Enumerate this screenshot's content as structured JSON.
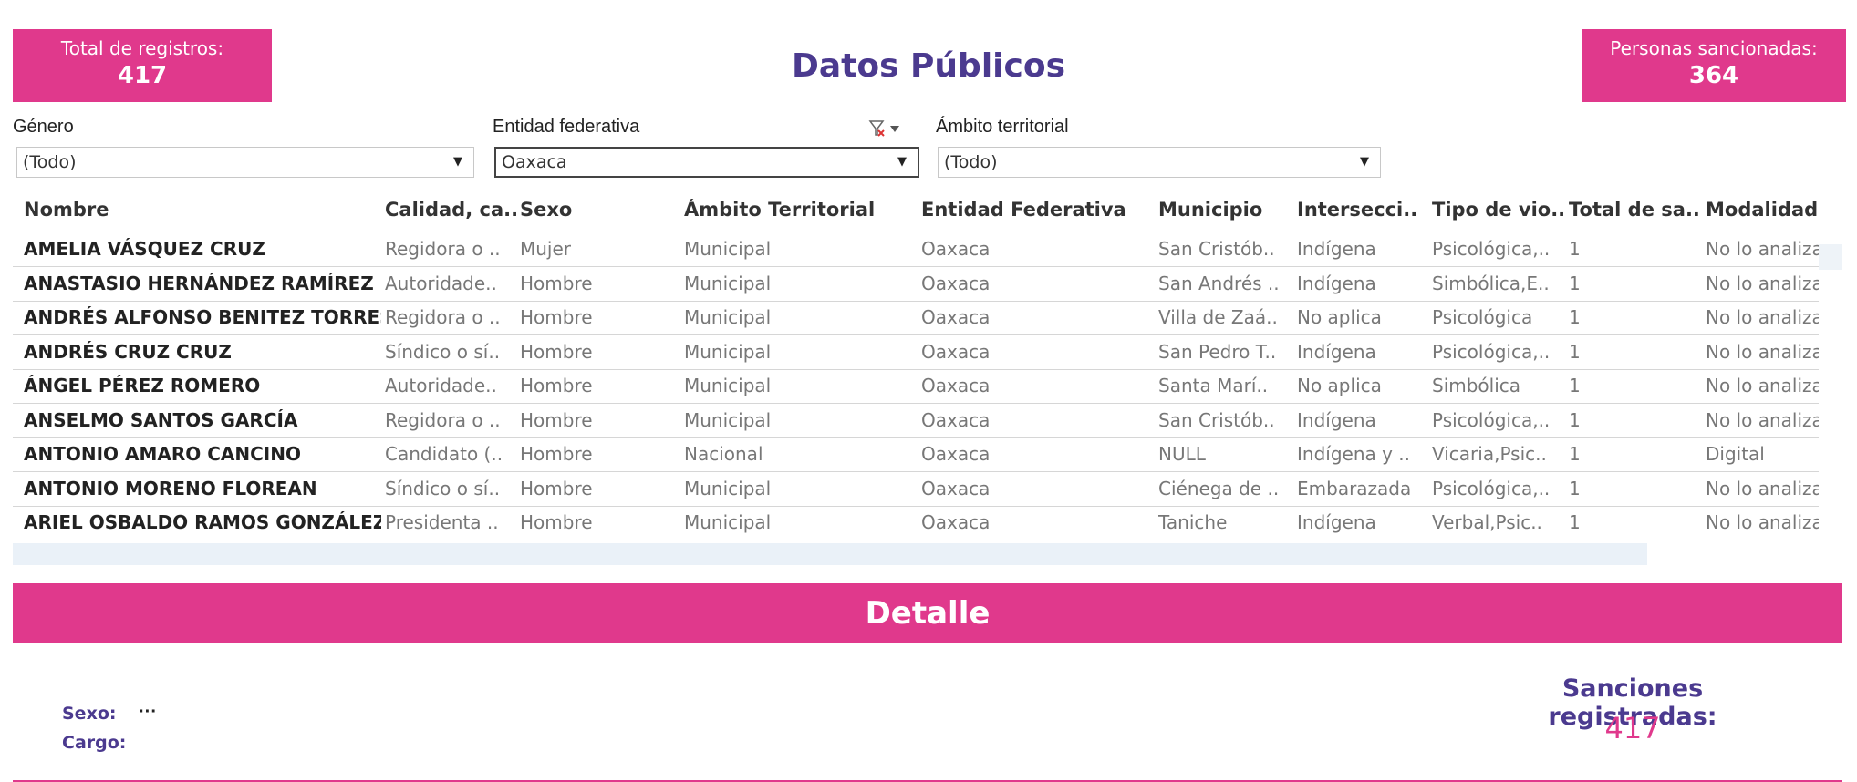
{
  "kpis": {
    "left": {
      "label": "Total de registros:",
      "value": "417"
    },
    "right": {
      "label": "Personas sancionadas:",
      "value": "364"
    }
  },
  "page_title": "Datos Públicos",
  "filters": {
    "genero": {
      "label": "Género",
      "value": "(Todo)"
    },
    "entidad": {
      "label": "Entidad federativa",
      "value": "Oaxaca"
    },
    "ambito": {
      "label": "Ámbito territorial",
      "value": "(Todo)"
    }
  },
  "icons": {
    "filter_clear": "filter-clear-icon",
    "dropdown": "chevron-down-icon"
  },
  "table": {
    "columns": [
      "Nombre",
      "Calidad, ca..",
      "Sexo",
      "Ámbito Territorial",
      "Entidad Federativa",
      "Municipio",
      "Intersecci..",
      "Tipo de vio..",
      "Total de sa..",
      "Modalidad.."
    ],
    "rows": [
      [
        "AMELIA VÁSQUEZ CRUZ",
        "Regidora o ..",
        "Mujer",
        "Municipal",
        "Oaxaca",
        "San Cristób..",
        "Indígena",
        "Psicológica,..",
        "1",
        "No lo analiza"
      ],
      [
        "ANASTASIO HERNÁNDEZ RAMÍREZ",
        "Autoridade..",
        "Hombre",
        "Municipal",
        "Oaxaca",
        "San Andrés ..",
        "Indígena",
        "Simbólica,E..",
        "1",
        "No lo analiza"
      ],
      [
        "ANDRÉS ALFONSO BENITEZ TORRES",
        "Regidora o ..",
        "Hombre",
        "Municipal",
        "Oaxaca",
        "Villa de Zaá..",
        "No aplica",
        "Psicológica",
        "1",
        "No lo analiza"
      ],
      [
        "ANDRÉS CRUZ CRUZ",
        "Síndico o sí..",
        "Hombre",
        "Municipal",
        "Oaxaca",
        "San Pedro T..",
        "Indígena",
        "Psicológica,..",
        "1",
        "No lo analiza"
      ],
      [
        "ÁNGEL PÉREZ ROMERO",
        "Autoridade..",
        "Hombre",
        "Municipal",
        "Oaxaca",
        "Santa Marí..",
        "No aplica",
        "Simbólica",
        "1",
        "No lo analiza"
      ],
      [
        "ANSELMO SANTOS GARCÍA",
        "Regidora o ..",
        "Hombre",
        "Municipal",
        "Oaxaca",
        "San Cristób..",
        "Indígena",
        "Psicológica,..",
        "1",
        "No lo analiza"
      ],
      [
        "ANTONIO AMARO CANCINO",
        "Candidato (..",
        "Hombre",
        "Nacional",
        "Oaxaca",
        "NULL",
        "Indígena y ..",
        "Vicaria,Psic..",
        "1",
        "Digital"
      ],
      [
        "ANTONIO MORENO FLOREAN",
        "Síndico o sí..",
        "Hombre",
        "Municipal",
        "Oaxaca",
        "Ciénega de ..",
        "Embarazada",
        "Psicológica,..",
        "1",
        "No lo analiza"
      ],
      [
        "ARIEL OSBALDO RAMOS GONZÁLEZ",
        "Presidenta ..",
        "Hombre",
        "Municipal",
        "Oaxaca",
        "Taniche",
        "Indígena",
        "Verbal,Psic..",
        "1",
        "No lo analiza"
      ]
    ]
  },
  "detalle": {
    "banner": "Detalle",
    "sexo_label": "Sexo:",
    "sexo_value": "···",
    "cargo_label": "Cargo:",
    "sanciones_label": "Sanciones registradas:",
    "sanciones_value": "417"
  },
  "colors": {
    "accent": "#e0398c",
    "title": "#4b3a8f"
  }
}
